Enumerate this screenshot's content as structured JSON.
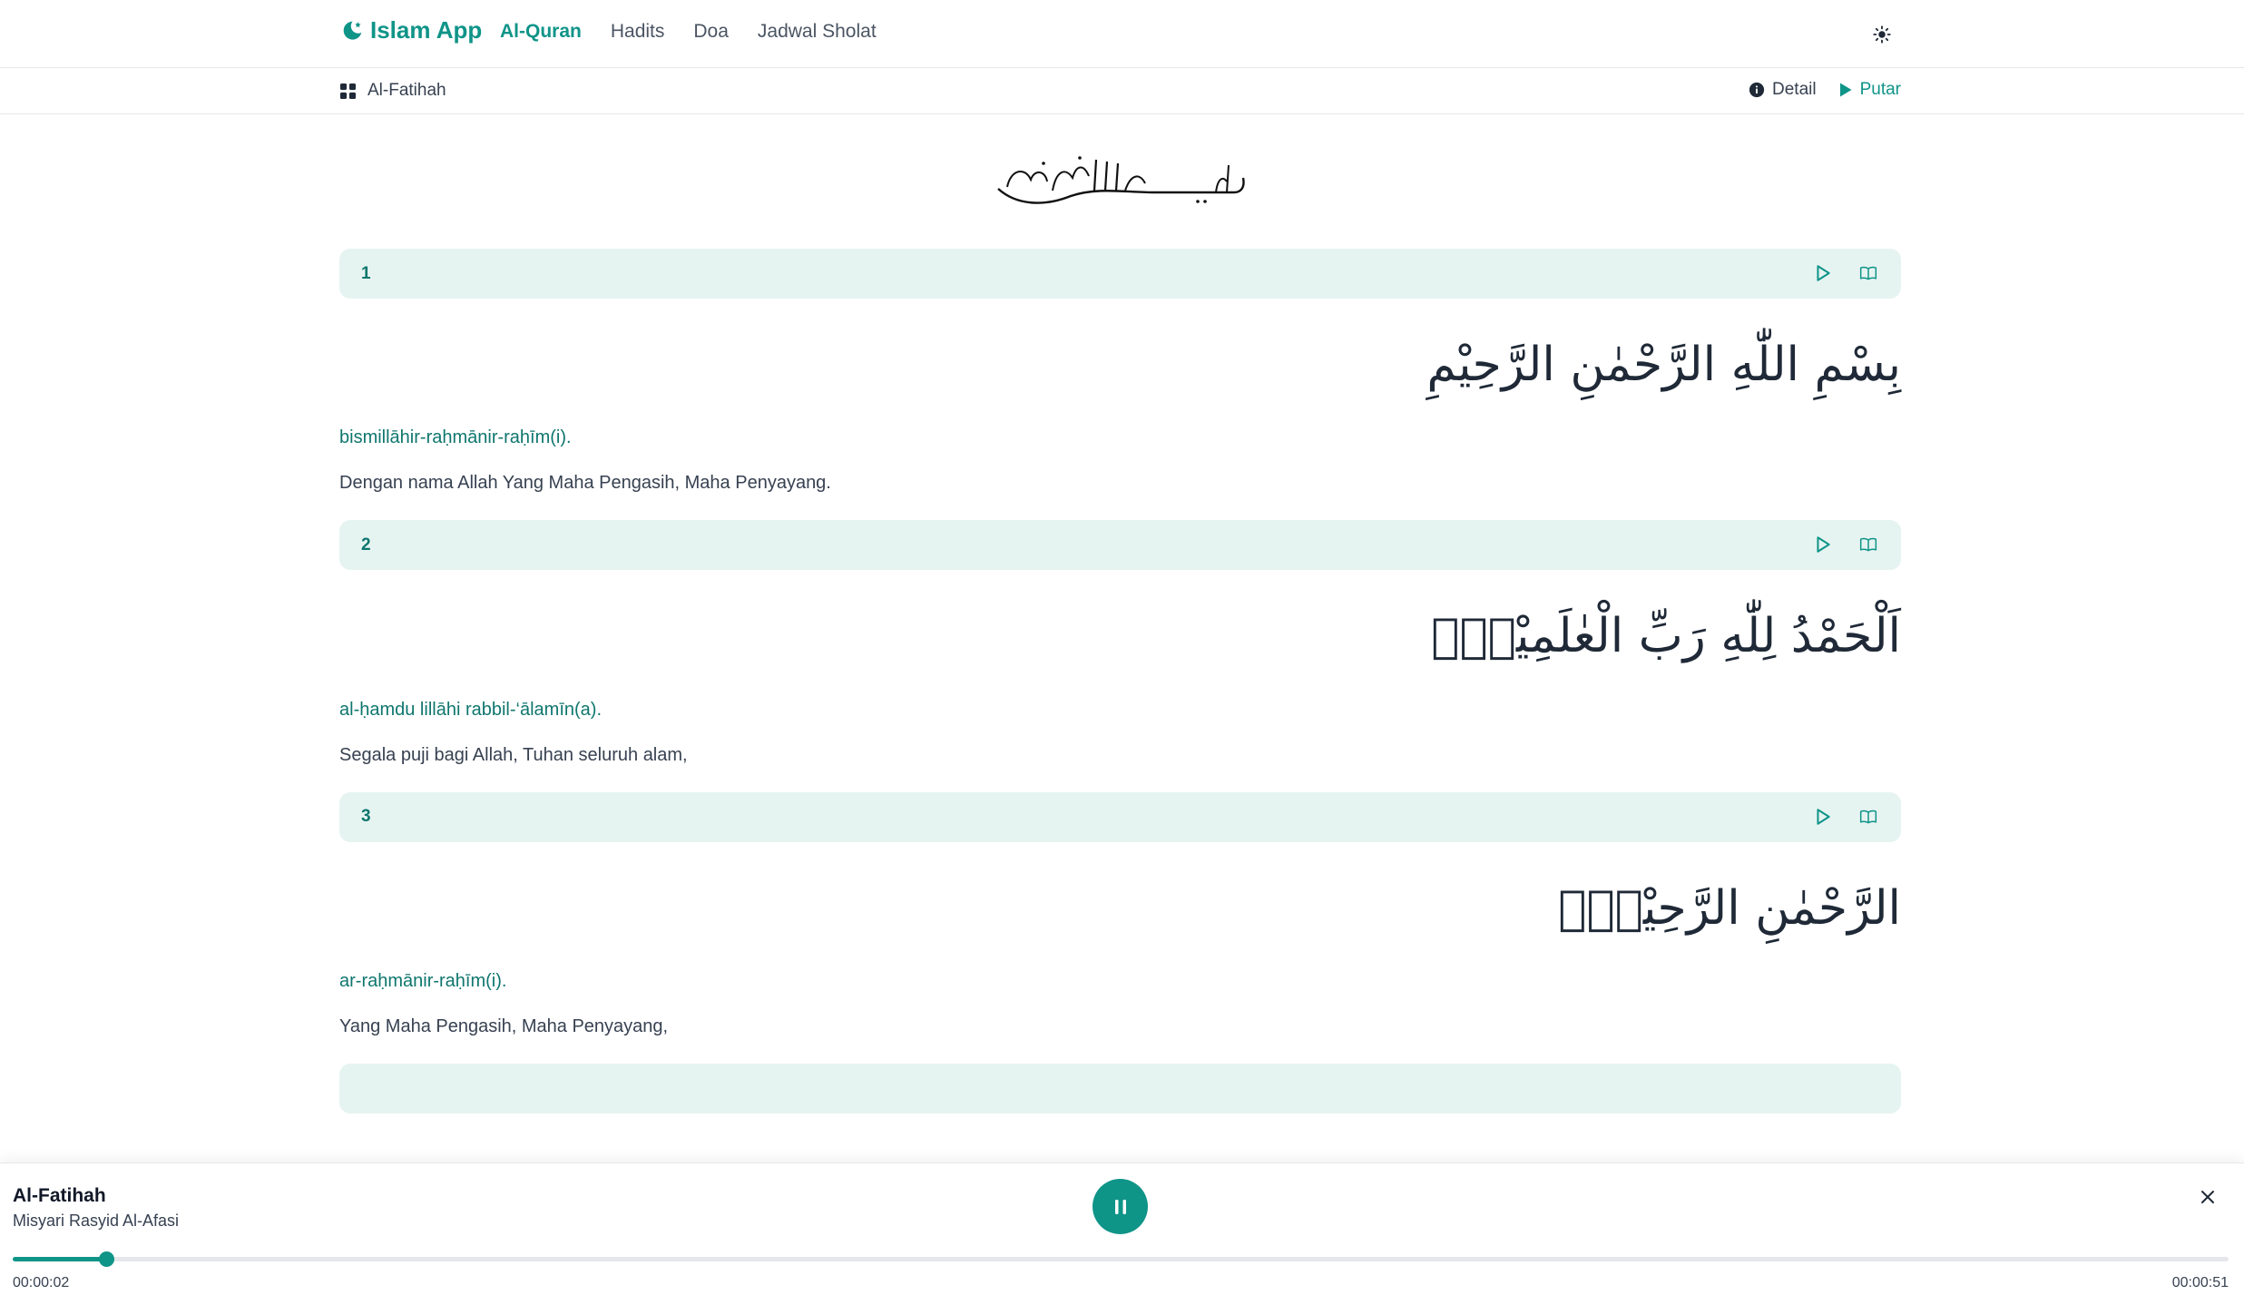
{
  "header": {
    "brand": "Islam App",
    "nav": [
      {
        "label": "Al-Quran",
        "active": true
      },
      {
        "label": "Hadits",
        "active": false
      },
      {
        "label": "Doa",
        "active": false
      },
      {
        "label": "Jadwal Sholat",
        "active": false
      }
    ],
    "theme_icon": "sun-icon"
  },
  "subbar": {
    "surah_name": "Al-Fatihah",
    "detail_label": "Detail",
    "play_label": "Putar"
  },
  "ayat": [
    {
      "number": "1",
      "arabic": "بِسْمِ اللّٰهِ الرَّحْمٰنِ الرَّحِيْمِ",
      "latin": "bismillāhir-raḥmānir-raḥīm(i).",
      "translation": "Dengan nama Allah Yang Maha Pengasih, Maha Penyayang."
    },
    {
      "number": "2",
      "arabic": "اَلْحَمْدُ لِلّٰهِ رَبِّ الْعٰلَمِيْنَۙ",
      "latin": "al-ḥamdu lillāhi rabbil-‘ālamīn(a).",
      "translation": "Segala puji bagi Allah, Tuhan seluruh alam,"
    },
    {
      "number": "3",
      "arabic": "الرَّحْمٰنِ الرَّحِيْمِۙ",
      "latin": "ar-raḥmānir-raḥīm(i).",
      "translation": "Yang Maha Pengasih, Maha Penyayang,"
    }
  ],
  "player": {
    "title": "Al-Fatihah",
    "artist": "Misyari Rasyid Al-Afasi",
    "current_time": "00:00:02",
    "duration": "00:00:51",
    "progress": 0.042
  },
  "colors": {
    "accent": "#0f9488",
    "ayah_bar_bg": "#e6f4f1",
    "latin_text": "#0f766e"
  }
}
